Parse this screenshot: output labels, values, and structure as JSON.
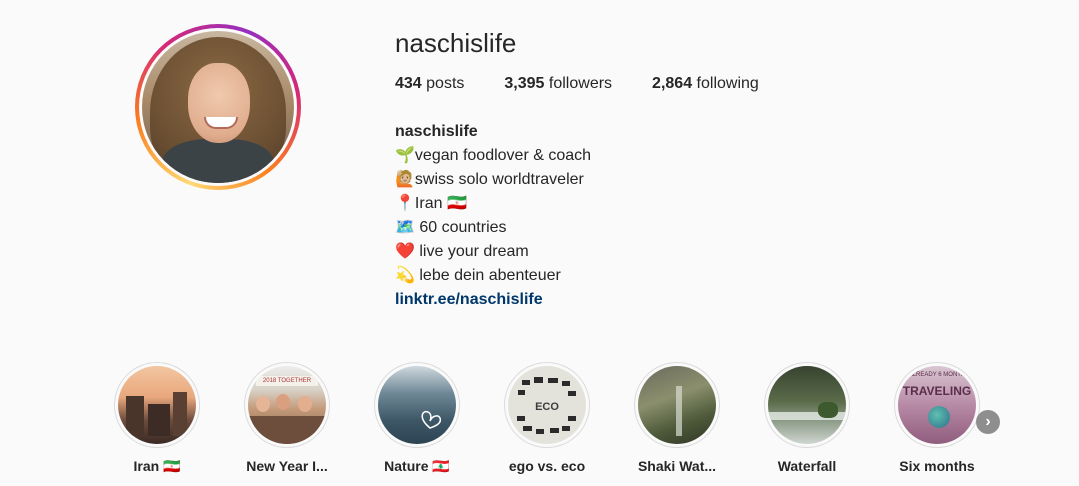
{
  "profile": {
    "username": "naschislife",
    "stats": {
      "posts_count": "434",
      "posts_label": "posts",
      "followers_count": "3,395",
      "followers_label": "followers",
      "following_count": "2,864",
      "following_label": "following"
    },
    "bio": {
      "name": "naschislife",
      "lines": [
        "🌱vegan foodlover & coach",
        "🙋🏼swiss solo worldtraveler",
        "📍Iran 🇮🇷",
        "🗺️ 60 countries",
        "❤️ live your dream",
        "💫 lebe dein abenteuer"
      ],
      "link": "linktr.ee/naschislife"
    }
  },
  "highlights": [
    {
      "label": "Iran 🇮🇷"
    },
    {
      "label": "New Year I..."
    },
    {
      "label": "Nature 🇱🇧"
    },
    {
      "label": "ego vs. eco"
    },
    {
      "label": "Shaki Wat..."
    },
    {
      "label": "Waterfall"
    },
    {
      "label": "Six months"
    }
  ],
  "highlight_text": {
    "newyear_sign": "2018 TOGETHER",
    "eco_text": "ECO",
    "six_text": "TRAVELING",
    "six_top_text": "ALREADY 6 MONTH"
  },
  "icons": {
    "next": "chevron-right-icon"
  }
}
